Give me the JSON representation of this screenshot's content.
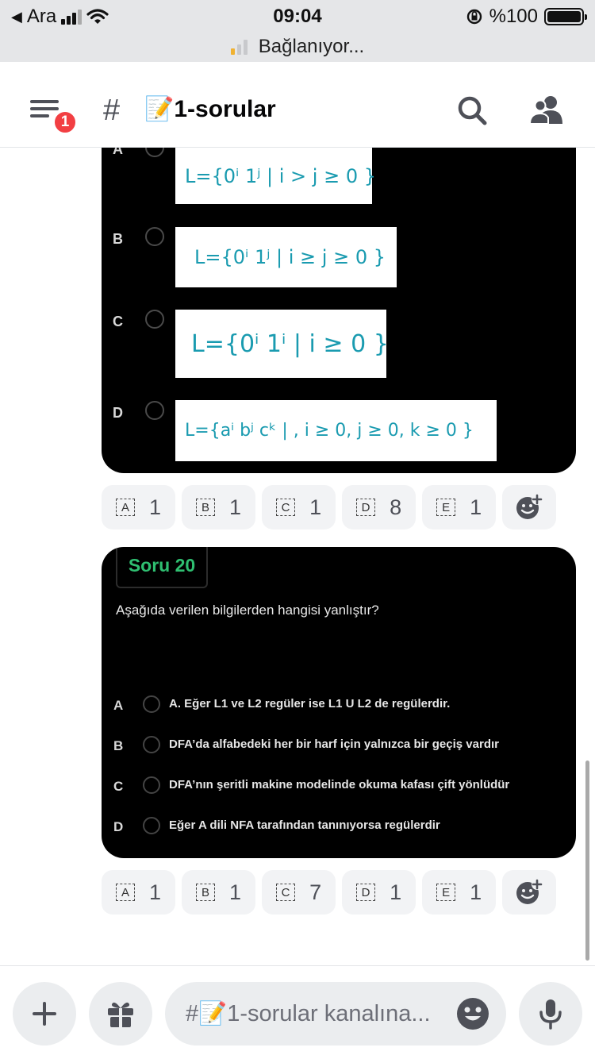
{
  "status_bar": {
    "carrier": "Ara",
    "time": "09:04",
    "battery": "%100"
  },
  "connection": {
    "text": "Bağlanıyor..."
  },
  "header": {
    "badge_count": "1",
    "channel_hash": "#",
    "channel_name": "📝1-sorular"
  },
  "q19": {
    "options": [
      {
        "letter": "A",
        "formula": "L={0ⁱ 1ʲ | i > j ≥ 0 }"
      },
      {
        "letter": "B",
        "formula": "L={0ⁱ 1ʲ | i ≥ j ≥ 0 }"
      },
      {
        "letter": "C",
        "formula": "L={0ⁱ 1ⁱ | i ≥ 0 }"
      },
      {
        "letter": "D",
        "formula": "L={aⁱ bʲ cᵏ | , i ≥ 0, j ≥ 0, k ≥ 0 }"
      }
    ],
    "reactions": [
      {
        "label": "A",
        "count": "1"
      },
      {
        "label": "B",
        "count": "1"
      },
      {
        "label": "C",
        "count": "1"
      },
      {
        "label": "D",
        "count": "8"
      },
      {
        "label": "E",
        "count": "1"
      }
    ]
  },
  "q20": {
    "title": "Soru 20",
    "question": "Aşağıda verilen bilgilerden hangisi yanlıştır?",
    "options": [
      {
        "letter": "A",
        "text": "A.    Eğer L1 ve L2 regüler ise L1 U  L2 de regülerdir."
      },
      {
        "letter": "B",
        "text": "DFA’da alfabedeki her bir harf için yalnızca bir geçiş vardır"
      },
      {
        "letter": "C",
        "text": "DFA’nın şeritli makine modelinde okuma kafası çift yönlüdür"
      },
      {
        "letter": "D",
        "text": "Eğer A dili NFA tarafından tanınıyorsa regülerdir"
      }
    ],
    "reactions": [
      {
        "label": "A",
        "count": "1"
      },
      {
        "label": "B",
        "count": "1"
      },
      {
        "label": "C",
        "count": "7"
      },
      {
        "label": "D",
        "count": "1"
      },
      {
        "label": "E",
        "count": "1"
      }
    ]
  },
  "composer": {
    "placeholder": "#📝1-sorular kanalına..."
  },
  "icons": {
    "menu": "menu-icon",
    "search": "search-icon",
    "members": "members-icon",
    "plus": "plus-icon",
    "gift": "gift-icon",
    "emoji": "emoji-icon",
    "mic": "mic-icon",
    "add_reaction": "add-reaction-icon"
  },
  "colors": {
    "accent_green": "#2fbf71",
    "formula_teal": "#1a9bb0",
    "badge_red": "#f23f43"
  }
}
